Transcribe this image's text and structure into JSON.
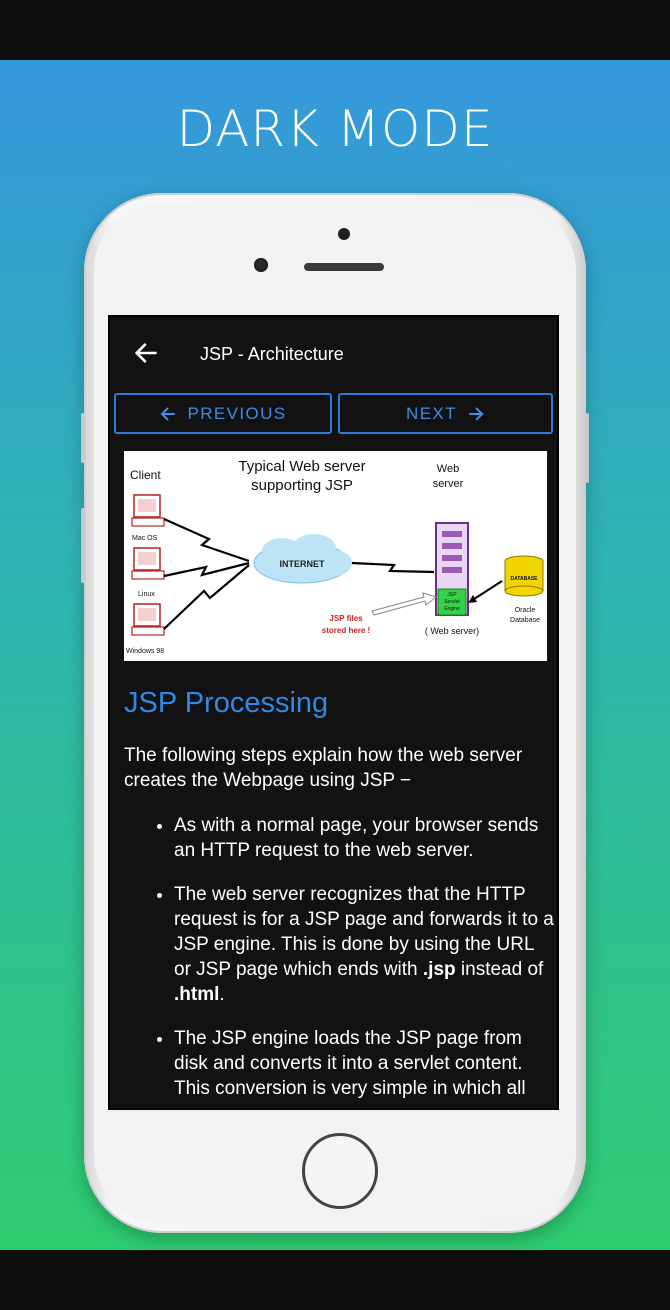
{
  "headline": "DARK MODE",
  "appbar": {
    "title": "JSP - Architecture",
    "back_icon": "arrow-left-icon"
  },
  "nav": {
    "previous_label": "PREVIOUS",
    "next_label": "NEXT",
    "accent": "#2f7bdc"
  },
  "diagram": {
    "title_line1": "Typical Web server",
    "title_line2": "supporting JSP",
    "client_label": "Client",
    "client_os": [
      "Mac OS",
      "Linux",
      "Windows 98"
    ],
    "internet_label": "INTERNET",
    "web_server_line1": "Web",
    "web_server_line2": "server",
    "database_label": "DATABASE",
    "oracle_line1": "Oracle",
    "oracle_line2": "Database",
    "jsp_files_line1": "JSP files",
    "jsp_files_line2": "stored here !",
    "engine_line1": "JSP",
    "engine_line2": "Servlet",
    "engine_line3": "Engine",
    "web_server_caption": "( Web server)"
  },
  "content": {
    "heading": "JSP Processing",
    "intro": "The following steps explain how the web server creates the Webpage using JSP −",
    "step1": "As with a normal page, your browser sends an HTTP request to the web server.",
    "step2_pre": "The web server recognizes that the HTTP request is for a JSP page and forwards it to a JSP engine. This is done by using the URL or JSP page which ends with ",
    "step2_bold1": ".jsp",
    "step2_mid": " instead of ",
    "step2_bold2": ".html",
    "step2_post": ".",
    "step3": "The JSP engine loads the JSP page from disk and converts it into a servlet content. This conversion is very simple in which all"
  }
}
